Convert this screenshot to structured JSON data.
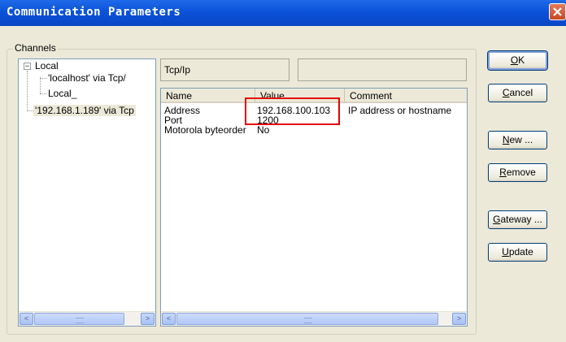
{
  "window": {
    "title": "Communication Parameters",
    "close_symbol": "×"
  },
  "channels": {
    "group_label": "Channels",
    "tree": [
      {
        "expander": "−",
        "label": "Local"
      },
      {
        "label": "'localhost' via Tcp/"
      },
      {
        "label": "Local_"
      },
      {
        "label": "'192.168.1.189' via Tcp"
      }
    ]
  },
  "driver": {
    "name": "Tcp/Ip",
    "description": ""
  },
  "params": {
    "columns": [
      "Name",
      "Value",
      "Comment"
    ],
    "rows": [
      {
        "name": "Address",
        "value": "192.168.100.103",
        "comment": "IP address or hostname"
      },
      {
        "name": "Port",
        "value": "1200",
        "comment": ""
      },
      {
        "name": "Motorola byteorder",
        "value": "No",
        "comment": ""
      }
    ]
  },
  "buttons": {
    "ok": {
      "pre": "",
      "ul": "O",
      "post": "K"
    },
    "cancel": {
      "pre": "",
      "ul": "C",
      "post": "ancel"
    },
    "new": {
      "pre": "",
      "ul": "N",
      "post": "ew ..."
    },
    "remove": {
      "pre": "",
      "ul": "R",
      "post": "emove"
    },
    "gateway": {
      "pre": "",
      "ul": "G",
      "post": "ateway ..."
    },
    "update": {
      "pre": "",
      "ul": "U",
      "post": "pdate"
    }
  },
  "scroll_arrows": {
    "left": "<",
    "right": ">"
  },
  "colors": {
    "titlebar": "#0a46c4",
    "highlight": "#e60000",
    "dialog_bg": "#ece9d8"
  }
}
